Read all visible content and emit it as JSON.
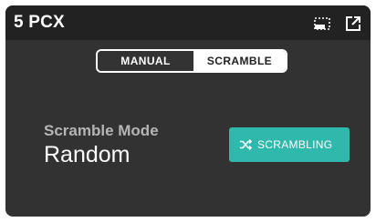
{
  "header": {
    "title": "5 PCX",
    "icons": [
      "fullscreen-select-icon",
      "open-external-icon"
    ]
  },
  "mode_toggle": {
    "options": [
      {
        "label": "MANUAL",
        "selected": false
      },
      {
        "label": "SCRAMBLE",
        "selected": true
      }
    ]
  },
  "scramble": {
    "mode_label": "Scramble Mode",
    "mode_value": "Random",
    "button_label": "SCRAMBLING",
    "button_icon": "shuffle-icon"
  },
  "colors": {
    "card_background": "#323232",
    "header_background": "#222222",
    "accent": "#2fb8ac",
    "muted_text": "#b5b5b5"
  }
}
